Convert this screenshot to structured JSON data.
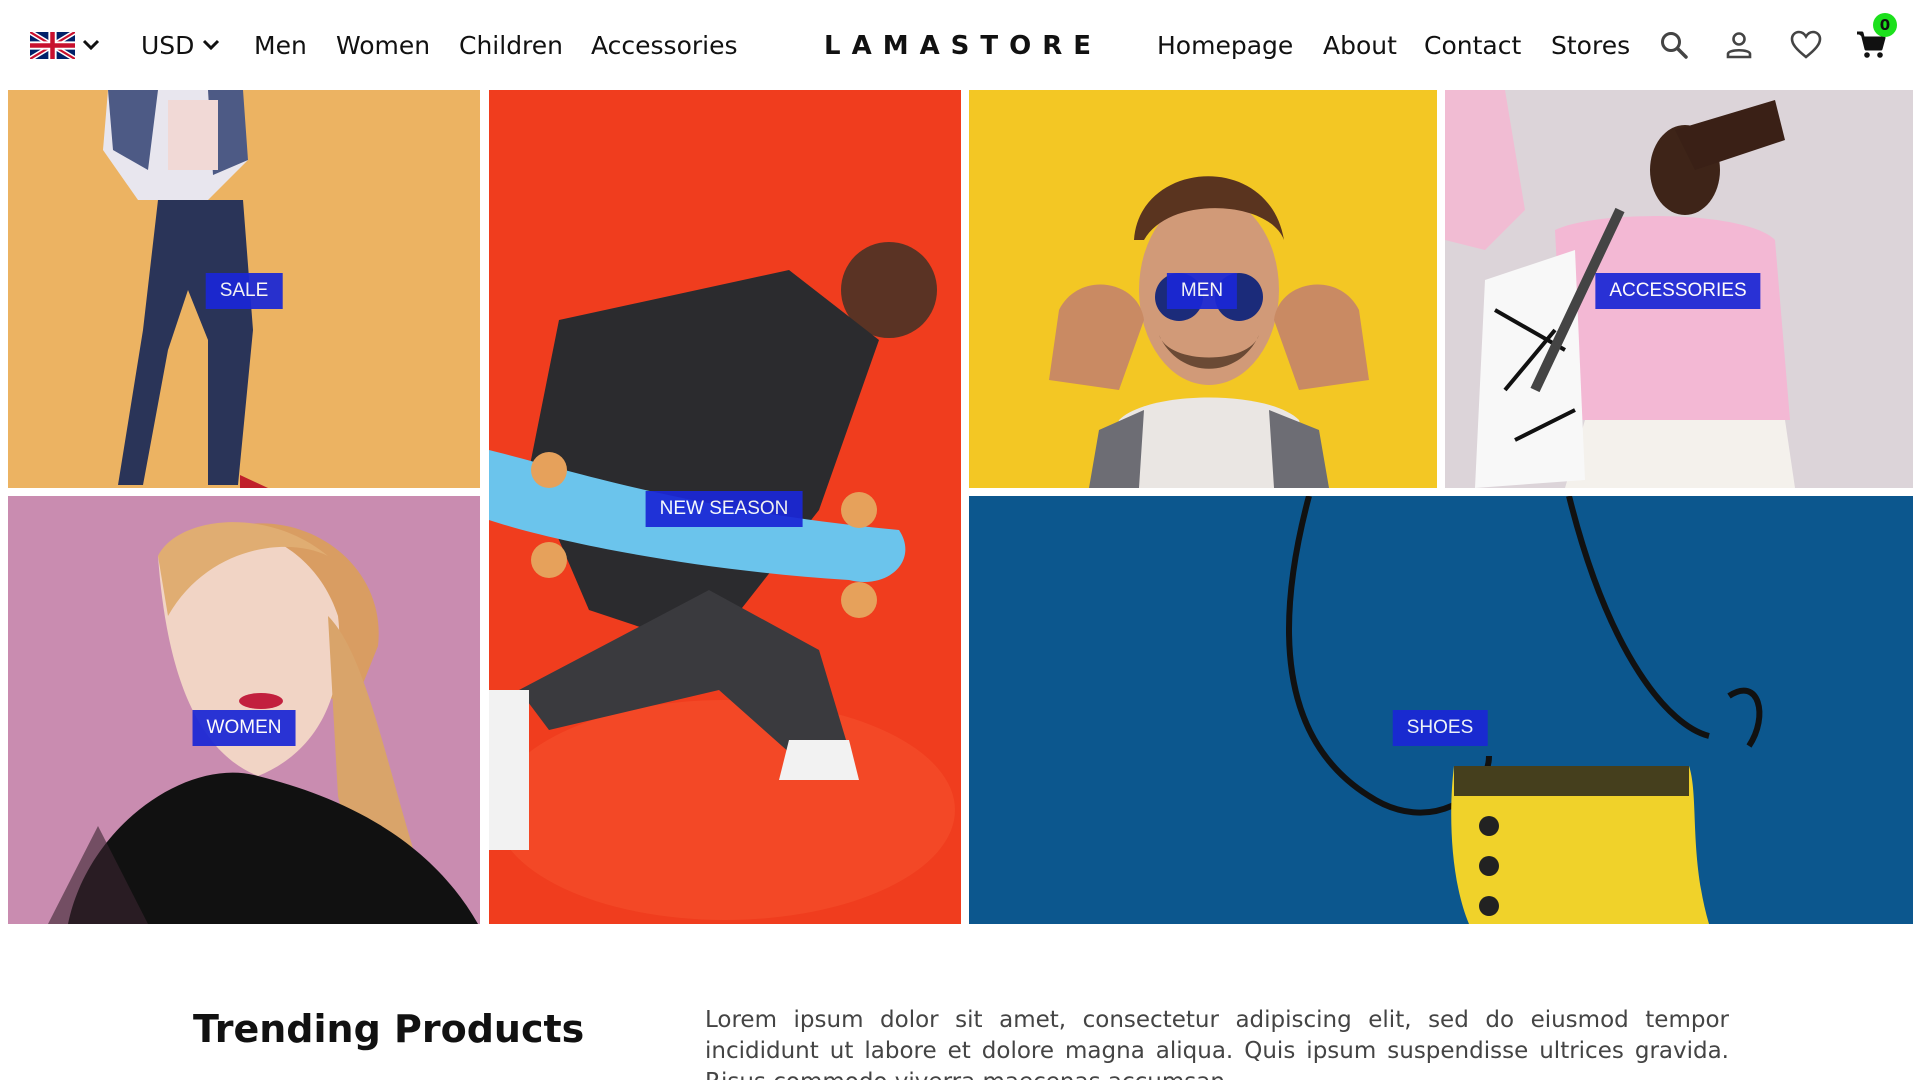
{
  "header": {
    "language_icon": "uk-flag-icon",
    "currency": "USD",
    "left_links": [
      "Men",
      "Women",
      "Children",
      "Accessories"
    ],
    "logo": "LAMASTORE",
    "right_links": [
      "Homepage",
      "About",
      "Contact",
      "Stores"
    ],
    "icons": [
      "search-icon",
      "user-icon",
      "heart-icon",
      "cart-icon"
    ],
    "cart_count": "0"
  },
  "categories": [
    {
      "label": "SALE",
      "bg": "#E9AE5C"
    },
    {
      "label": "NEW SEASON",
      "bg": "#F03D1E"
    },
    {
      "label": "MEN",
      "bg": "#F2C21A"
    },
    {
      "label": "ACCESSORIES",
      "bg": "#D9D0D6"
    },
    {
      "label": "WOMEN",
      "bg": "#C98CB0"
    },
    {
      "label": "SHOES",
      "bg": "#0E5D96"
    }
  ],
  "trending": {
    "title": "Trending Products",
    "description": "Lorem ipsum dolor sit amet, consectetur adipiscing elit, sed do eiusmod tempor incididunt ut labore et dolore magna aliqua. Quis ipsum suspendisse ultrices gravida. Risus commodo viverra maecenas accumsan"
  },
  "colors": {
    "label_bg": "#1A27D6",
    "badge": "#1CE01C"
  }
}
